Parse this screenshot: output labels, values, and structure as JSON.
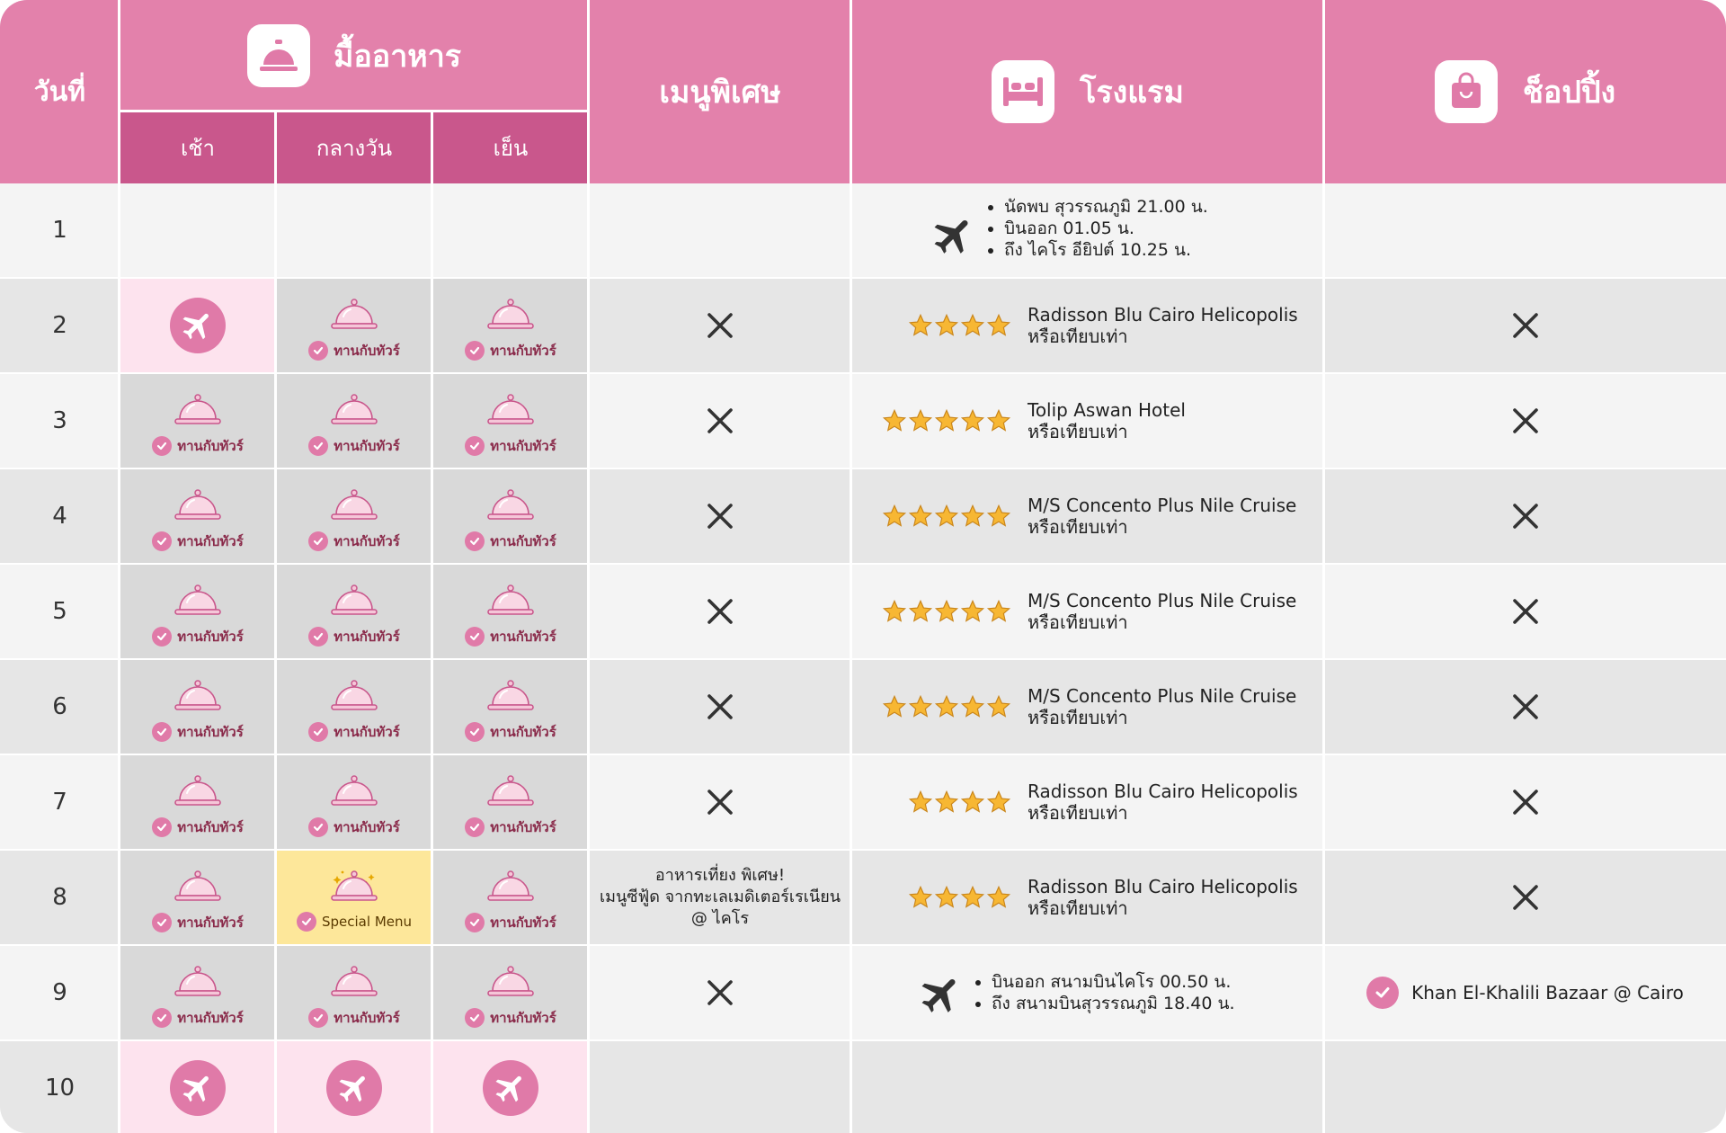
{
  "header": {
    "day_label": "วันที่",
    "meals_label": "มื้ออาหาร",
    "breakfast_label": "เช้า",
    "lunch_label": "กลางวัน",
    "dinner_label": "เย็น",
    "special_menu_label": "เมนูพิเศษ",
    "hotel_label": "โรงแรม",
    "shopping_label": "ช็อปปิ้ง"
  },
  "icons": {
    "meals": "service-bell-icon",
    "hotel": "bed-icon",
    "shopping": "shopping-bag-icon",
    "meal": "cloche-icon",
    "check": "check-icon",
    "flight": "airplane-icon",
    "none": "cross-icon",
    "star": "star-icon"
  },
  "colors": {
    "header_pink": "#e381ab",
    "subheader_pink": "#c9578c",
    "flight_cell": "#fde3ee",
    "special_cell": "#fde79a",
    "accent": "#e07aa8",
    "star": "#f7b733"
  },
  "meal_label": "ทานกับทัวร์",
  "special_meal_label": "Special Menu",
  "hotel_suffix": "หรือเทียบเท่า",
  "rows": [
    {
      "day": "1",
      "meals": [
        "empty",
        "empty",
        "empty"
      ],
      "special": "",
      "hotel": {
        "type": "flight",
        "lines": [
          "นัดพบ สุวรรณภูมิ 21.00 น.",
          "บินออก 01.05 น.",
          "ถึง ไคโร อียิปต์ 10.25 น."
        ]
      },
      "shopping": ""
    },
    {
      "day": "2",
      "meals": [
        "flight",
        "tour",
        "tour"
      ],
      "special": "none",
      "hotel": {
        "type": "hotel",
        "stars": 4,
        "name": "Radisson Blu Cairo Helicopolis"
      },
      "shopping": "none"
    },
    {
      "day": "3",
      "meals": [
        "tour",
        "tour",
        "tour"
      ],
      "special": "none",
      "hotel": {
        "type": "hotel",
        "stars": 5,
        "name": "Tolip Aswan Hotel"
      },
      "shopping": "none"
    },
    {
      "day": "4",
      "meals": [
        "tour",
        "tour",
        "tour"
      ],
      "special": "none",
      "hotel": {
        "type": "hotel",
        "stars": 5,
        "name": "M/S Concento Plus Nile Cruise"
      },
      "shopping": "none"
    },
    {
      "day": "5",
      "meals": [
        "tour",
        "tour",
        "tour"
      ],
      "special": "none",
      "hotel": {
        "type": "hotel",
        "stars": 5,
        "name": "M/S Concento Plus Nile Cruise"
      },
      "shopping": "none"
    },
    {
      "day": "6",
      "meals": [
        "tour",
        "tour",
        "tour"
      ],
      "special": "none",
      "hotel": {
        "type": "hotel",
        "stars": 5,
        "name": "M/S Concento Plus Nile Cruise"
      },
      "shopping": "none"
    },
    {
      "day": "7",
      "meals": [
        "tour",
        "tour",
        "tour"
      ],
      "special": "none",
      "hotel": {
        "type": "hotel",
        "stars": 4,
        "name": "Radisson Blu Cairo Helicopolis"
      },
      "shopping": "none"
    },
    {
      "day": "8",
      "meals": [
        "tour",
        "special",
        "tour"
      ],
      "special": "อาหารเที่ยง พิเศษ!\nเมนูซีฟู้ด จากทะเลเมดิเตอร์เรเนียน\n@ ไคโร",
      "hotel": {
        "type": "hotel",
        "stars": 4,
        "name": "Radisson Blu Cairo Helicopolis"
      },
      "shopping": "none"
    },
    {
      "day": "9",
      "meals": [
        "tour",
        "tour",
        "tour"
      ],
      "special": "none",
      "hotel": {
        "type": "flight",
        "lines": [
          "บินออก สนามบินไคโร 00.50 น.",
          "ถึง สนามบินสุวรรณภูมิ 18.40 น."
        ]
      },
      "shopping": "Khan El-Khalili Bazaar @ Cairo"
    },
    {
      "day": "10",
      "meals": [
        "flight",
        "flight",
        "flight"
      ],
      "special": "",
      "hotel": {
        "type": "empty"
      },
      "shopping": ""
    }
  ]
}
